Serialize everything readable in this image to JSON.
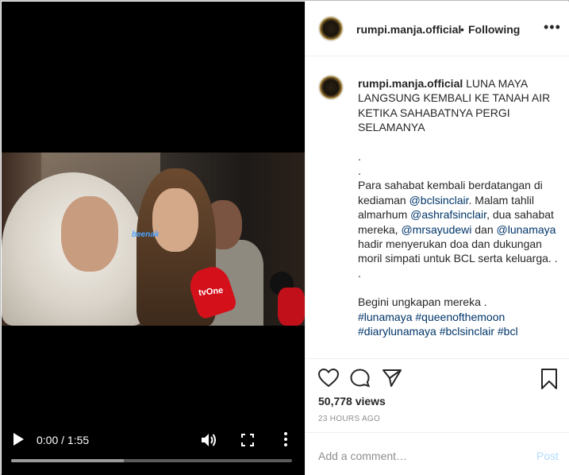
{
  "post": {
    "username": "rumpi.manja.official",
    "separator": "•",
    "follow_state": "Following",
    "options_icon": "more-horizontal-icon"
  },
  "video": {
    "time": "0:00 / 1:55",
    "buffered_fraction": 0.4,
    "mic_logo": "tvOne",
    "watermark": "beenak"
  },
  "caption": {
    "username": "rumpi.manja.official",
    "headline": "LUNA MAYA LANGSUNG KEMBALI KE TANAH AIR KETIKA SAHABATNYA PERGI SELAMANYA",
    "dot1": ".",
    "dot2": ".",
    "p1_a": "Para sahabat kembali berdatangan di kediaman ",
    "mention_bcl": "@bclsinclair",
    "p1_b": ". Malam tahlil almarhum ",
    "mention_ashraf": "@ashrafsinclair",
    "p1_c": ", dua sahabat mereka, ",
    "mention_sayu": "@mrsayudewi",
    "p1_d": " dan ",
    "mention_luna": "@lunamaya",
    "p1_e": " hadir menyerukan doa dan dukungan moril simpati untuk BCL serta keluarga. .",
    "dot3": ".",
    "p2": "Begini ungkapan mereka .",
    "tag1": "#lunamaya",
    "tag2": "#queenofthemoon",
    "tag3": "#diarylunamaya",
    "tag4": "#bclsinclair",
    "tag5": "#bcl"
  },
  "stats": {
    "views": "50,778 views",
    "time_ago": "23 HOURS AGO"
  },
  "comment_box": {
    "placeholder": "Add a comment…",
    "post_label": "Post"
  },
  "colors": {
    "link": "#003569",
    "muted": "#8e8e8e",
    "post_disabled": "#b3dbff"
  }
}
